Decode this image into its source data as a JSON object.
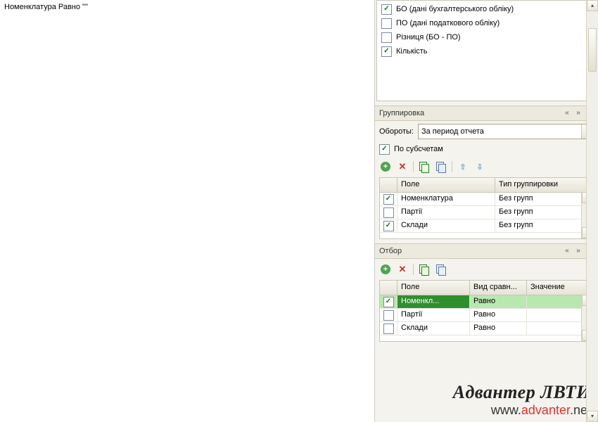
{
  "filter_preview": "Номенклатура Равно \"\"",
  "indicators": [
    {
      "label": "БО (дані бухгалтерського обліку)",
      "checked": true
    },
    {
      "label": "ПО (дані податкового обліку)",
      "checked": false
    },
    {
      "label": "Різниця (БО - ПО)",
      "checked": false
    },
    {
      "label": "Кількість",
      "checked": true
    }
  ],
  "grouping": {
    "title": "Группировка",
    "turnovers_label": "Обороты:",
    "turnovers_value": "За период отчета",
    "by_subaccounts_label": "По субсчетам",
    "by_subaccounts_checked": true,
    "columns": {
      "field": "Поле",
      "type": "Тип группировки"
    },
    "rows": [
      {
        "checked": true,
        "field": "Номенклатура",
        "type": "Без групп"
      },
      {
        "checked": false,
        "field": "Партії",
        "type": "Без групп"
      },
      {
        "checked": true,
        "field": "Склади",
        "type": "Без групп"
      }
    ]
  },
  "filter": {
    "title": "Отбор",
    "columns": {
      "field": "Поле",
      "compare": "Вид сравн...",
      "value": "Значение"
    },
    "rows": [
      {
        "checked": true,
        "field": "Номенкл...",
        "compare": "Равно",
        "value": "",
        "selected": true
      },
      {
        "checked": false,
        "field": "Партії",
        "compare": "Равно",
        "value": ""
      },
      {
        "checked": false,
        "field": "Склади",
        "compare": "Равно",
        "value": ""
      }
    ]
  },
  "watermark": {
    "line1": "Адвантер ЛВТИ",
    "line2_prefix": "www.",
    "line2_accent": "advanter",
    "line2_suffix": ".net"
  }
}
